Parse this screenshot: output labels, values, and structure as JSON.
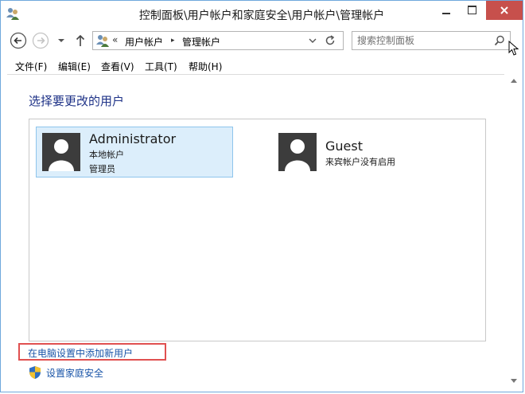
{
  "window": {
    "title": "控制面板\\用户帐户和家庭安全\\用户帐户\\管理帐户",
    "app_icon": "users-icon",
    "controls": [
      "minimize-icon",
      "maximize-icon",
      "close-icon"
    ]
  },
  "address": {
    "overflow": "«",
    "segments": [
      "用户帐户",
      "管理帐户"
    ],
    "separator": "▸"
  },
  "search": {
    "placeholder": "搜索控制面板",
    "value": ""
  },
  "menu": {
    "items": [
      "文件(F)",
      "编辑(E)",
      "查看(V)",
      "工具(T)",
      "帮助(H)"
    ]
  },
  "main": {
    "heading": "选择要更改的用户",
    "users": [
      {
        "name": "Administrator",
        "lines": [
          "本地帐户",
          "管理员"
        ],
        "selected": true
      },
      {
        "name": "Guest",
        "lines": [
          "来宾帐户没有启用"
        ],
        "selected": false
      }
    ],
    "add_user_link": "在电脑设置中添加新用户",
    "family_link": "设置家庭安全"
  },
  "colors": {
    "heading": "#1e3287",
    "link": "#1a55a8",
    "selected_tile": "#dceefb",
    "selected_border": "#8ec5ec",
    "highlight_box": "#e05050",
    "close_button": "#c7504c"
  }
}
